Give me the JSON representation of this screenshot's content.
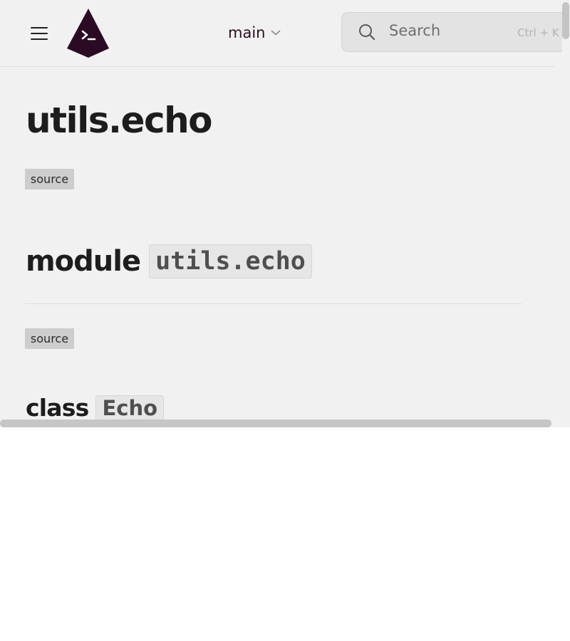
{
  "header": {
    "menu_icon": "hamburger-menu-icon",
    "logo_icon": "terminal-prompt-logo",
    "branch": {
      "label": "main",
      "icon": "chevron-down-icon"
    },
    "search": {
      "placeholder": "Search",
      "shortcut": "Ctrl + K",
      "icon": "search-icon"
    }
  },
  "colors": {
    "background": "#f1f1f1",
    "logo": "#2b0b24",
    "text": "#1d1d1d",
    "badge": "#cdcdcd"
  },
  "main": {
    "title": "utils.echo",
    "title_source_label": "source",
    "module": {
      "keyword": "module",
      "name": "utils.echo",
      "source_label": "source"
    },
    "class": {
      "keyword": "class",
      "name": "Echo"
    }
  }
}
